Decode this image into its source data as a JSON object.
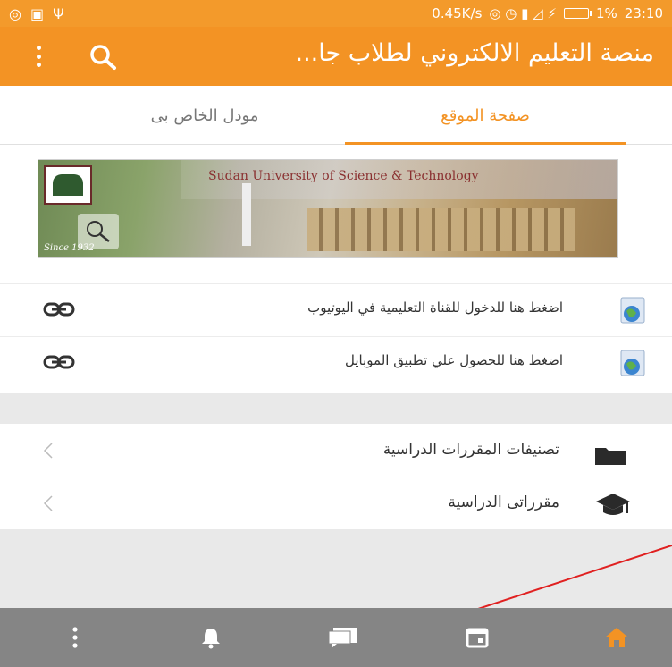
{
  "status_bar": {
    "speed": "0.45K/s",
    "battery": "1%",
    "time": "23:10"
  },
  "app_bar": {
    "title": "منصة التعليم الالكتروني لطلاب جا...",
    "search_icon": "search-icon",
    "menu_icon": "more-vert-icon"
  },
  "tabs": [
    {
      "label": "صفحة الموقع",
      "active": true
    },
    {
      "label": "مودل الخاص بى",
      "active": false
    }
  ],
  "banner": {
    "university": "Sudan University of Science & Technology",
    "since": "Since 1932"
  },
  "links": [
    {
      "label": "اضغط هنا للدخول للقناة التعليمية في اليوتيوب",
      "icon": "link-icon"
    },
    {
      "label": "اضغط هنا للحصول علي تطبيق الموبايل",
      "icon": "link-icon"
    }
  ],
  "sections": [
    {
      "label": "تصنيفات المقررات الدراسية",
      "icon": "folder-icon"
    },
    {
      "label": "مقرراتى الدراسية",
      "icon": "graduation-cap-icon"
    }
  ],
  "bottom_nav": [
    {
      "name": "more",
      "icon": "more-vert-icon"
    },
    {
      "name": "notifications",
      "icon": "bell-icon"
    },
    {
      "name": "messages",
      "icon": "chat-icon"
    },
    {
      "name": "calendar",
      "icon": "calendar-icon"
    },
    {
      "name": "home",
      "icon": "home-icon",
      "active": true
    }
  ],
  "colors": {
    "primary": "#f39324",
    "status_bar": "#f39a2b",
    "nav_bar": "#858585",
    "annotation_arrow": "#e02020"
  }
}
